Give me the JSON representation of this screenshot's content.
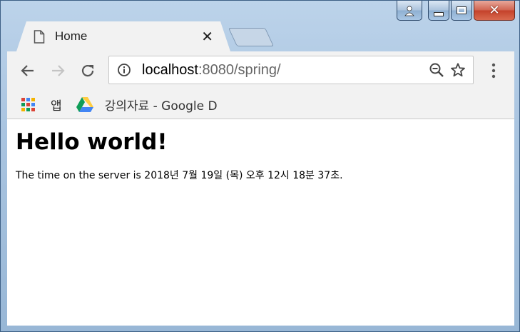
{
  "tab": {
    "title": "Home",
    "close_glyph": "✕"
  },
  "window_controls": {
    "close_glyph": "✕"
  },
  "address_bar": {
    "host": "localhost",
    "rest": ":8080/spring/"
  },
  "bookmarks": [
    {
      "label": "앱",
      "icon": "apps-grid-icon"
    },
    {
      "label": "강의자료 - Google D",
      "icon": "google-drive-icon"
    }
  ],
  "page": {
    "heading": "Hello world!",
    "server_time": "The time on the server is 2018년 7월 19일 (목) 오후 12시 18분 37초."
  },
  "colors": {
    "tab_bg": "#f2f2f2",
    "close_button": "#c4412a",
    "drive_green": "#0f9d58",
    "drive_yellow": "#ffcd40",
    "drive_blue": "#4285f4"
  }
}
